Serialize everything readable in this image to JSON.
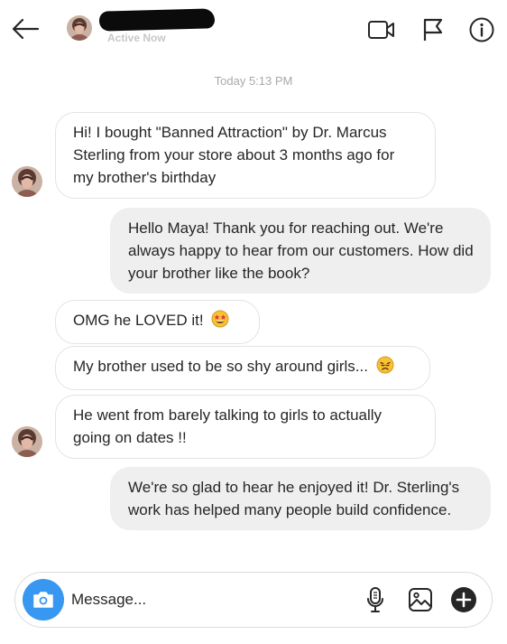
{
  "header": {
    "status": "Active Now",
    "icons": [
      "back-arrow-icon",
      "video-camera-icon",
      "flag-icon",
      "info-icon"
    ]
  },
  "timestamp": "Today 5:13 PM",
  "messages": [
    {
      "from": "them",
      "text": "Hi! I bought \"Banned Attraction\" by Dr. Marcus Sterling from your store about 3 months ago for my brother's birthday"
    },
    {
      "from": "me",
      "text": "Hello Maya! Thank you for reaching out. We're always happy to hear from our customers. How did your brother like the book?"
    },
    {
      "from": "them",
      "text": "OMG he LOVED it!",
      "emoji": "star-struck-emoji"
    },
    {
      "from": "them",
      "text": "My brother used to be so shy around girls...",
      "emoji": "disappointed-emoji"
    },
    {
      "from": "them",
      "text": "He went from barely talking to girls to actually going on dates !!"
    },
    {
      "from": "me",
      "text": "We're so glad to hear he enjoyed it! Dr. Sterling's work has helped many people build confidence."
    }
  ],
  "composer": {
    "placeholder": "Message...",
    "icons": [
      "camera-icon",
      "microphone-icon",
      "image-icon",
      "plus-icon"
    ]
  },
  "colors": {
    "accent": "#3897f0",
    "incoming_bubble_border": "#e3e3e3",
    "outgoing_bubble_bg": "#efefef",
    "muted_text": "#a8a8a8"
  }
}
